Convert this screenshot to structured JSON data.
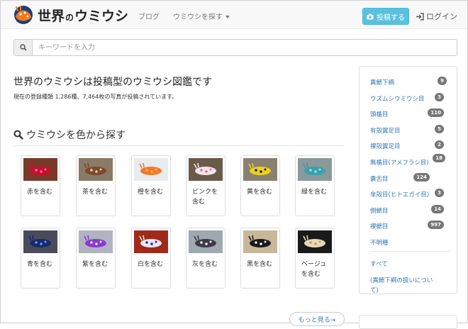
{
  "header": {
    "logo_text_1": "世界",
    "logo_text_2": "の",
    "logo_text_3": "ウミウシ",
    "nav_blog": "ブログ",
    "nav_search": "ウミウシを探す",
    "post_label": "投稿する",
    "login_label": "ログイン"
  },
  "search": {
    "placeholder": "キーワードを入力"
  },
  "main": {
    "headline": "世界のウミウシは投稿型のウミウシ図鑑です",
    "stats": "現在の登録種類 1,286種、7,464枚の写真が投稿されています。",
    "section_title": "ウミウシを色から探す",
    "more_label": "もっと見る→"
  },
  "colors": [
    {
      "label": "赤を含む",
      "bg": "#7a3a2a",
      "body": "#c8102e",
      "spot": "#ff6fa0"
    },
    {
      "label": "茶を含む",
      "bg": "#8a7a66",
      "body": "#7a4a2a",
      "spot": "#e8d0a8"
    },
    {
      "label": "橙を含む",
      "bg": "#e8ecee",
      "body": "#f07a2a",
      "spot": "#ffb060"
    },
    {
      "label": "ピンクを含む",
      "bg": "#6a5a4a",
      "body": "#f0e4e8",
      "spot": "#e070a0"
    },
    {
      "label": "黄を含む",
      "bg": "#8a8070",
      "body": "#f0d020",
      "spot": "#1a1a1a"
    },
    {
      "label": "緑を含む",
      "bg": "#8a9a9a",
      "body": "#3aa0b0",
      "spot": "#a0e0c0"
    },
    {
      "label": "青を含む",
      "bg": "#4a4a5a",
      "body": "#1a2a6a",
      "spot": "#5aa0f0"
    },
    {
      "label": "紫を含む",
      "bg": "#b0b4c0",
      "body": "#8a3ad0",
      "spot": "#f0f0f0"
    },
    {
      "label": "白を含む",
      "bg": "#a02a1a",
      "body": "#e8e8f0",
      "spot": "#2a2a8a"
    },
    {
      "label": "灰を含む",
      "bg": "#a0a8b0",
      "body": "#3a3a4a",
      "spot": "#f0f0f0"
    },
    {
      "label": "黒を含む",
      "bg": "#c8b89a",
      "body": "#1a1a1a",
      "spot": "#f0f0f0"
    },
    {
      "label": "ベージュを含む",
      "bg": "#1a1a1a",
      "body": "#e8d8b8",
      "spot": "#c89a60"
    }
  ],
  "sidebar": {
    "items": [
      {
        "label": "異鰓下綱",
        "count": "9"
      },
      {
        "label": "ウズムシウミウシ目",
        "count": "3"
      },
      {
        "label": "頭楯目",
        "count": "110"
      },
      {
        "label": "有殻翼足目",
        "count": "5"
      },
      {
        "label": "裸殻翼足目",
        "count": "2"
      },
      {
        "label": "無楯目(アメフラシ目)",
        "count": "18"
      },
      {
        "label": "嚢舌目",
        "count": "124"
      },
      {
        "label": "傘殻目(ヒトエガイ目)",
        "count": "3"
      },
      {
        "label": "側鰓目",
        "count": "14"
      },
      {
        "label": "裸鰓目",
        "count": "997"
      },
      {
        "label": "不明種",
        "count": ""
      }
    ],
    "all_label": "すべて",
    "note_label_1": "(異鰓下綱の扱いについ",
    "note_label_2": "て)"
  },
  "accent": "#5bc0de",
  "link_color": "#337ab7"
}
